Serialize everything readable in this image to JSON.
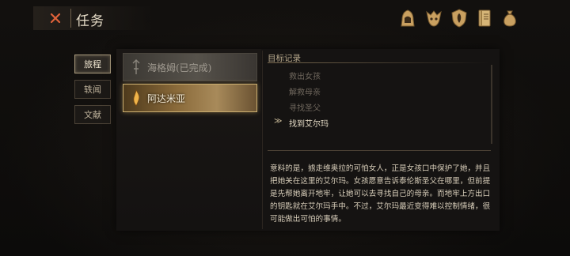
{
  "header": {
    "title": "任务",
    "close_icon": "close-x-icon",
    "accent": "#e0623a"
  },
  "top_icons": [
    {
      "name": "hooded-figure-icon"
    },
    {
      "name": "creature-head-icon"
    },
    {
      "name": "shield-emblem-icon"
    },
    {
      "name": "journal-book-icon"
    },
    {
      "name": "sack-bag-icon"
    }
  ],
  "side_tabs": [
    {
      "label": "旅程",
      "active": true
    },
    {
      "label": "轶闻",
      "active": false
    },
    {
      "label": "文献",
      "active": false
    }
  ],
  "quests": [
    {
      "label": "海格姆(已完成)",
      "completed": true
    },
    {
      "label": "阿达米亚",
      "completed": false,
      "selected": true
    }
  ],
  "objectives": {
    "header": "目标记录",
    "items": [
      {
        "label": "救出女孩",
        "done": true
      },
      {
        "label": "解救母亲",
        "done": true
      },
      {
        "label": "寻找圣父",
        "done": true
      },
      {
        "label": "找到艾尔玛",
        "done": false,
        "current": true
      }
    ],
    "current_marker": "≫"
  },
  "description": "意料的是，掳走维奥拉的可怕女人，正是女孩口中保护了她，并且把她关在这里的艾尔玛。女孩愿意告诉泰伦斯圣父在哪里，但前提是先帮她离开地牢，让她可以去寻找自己的母亲。而地牢上方出口的钥匙就在艾尔玛手中。不过，艾尔玛最近变得难以控制情绪，很可能做出可怕的事情。"
}
